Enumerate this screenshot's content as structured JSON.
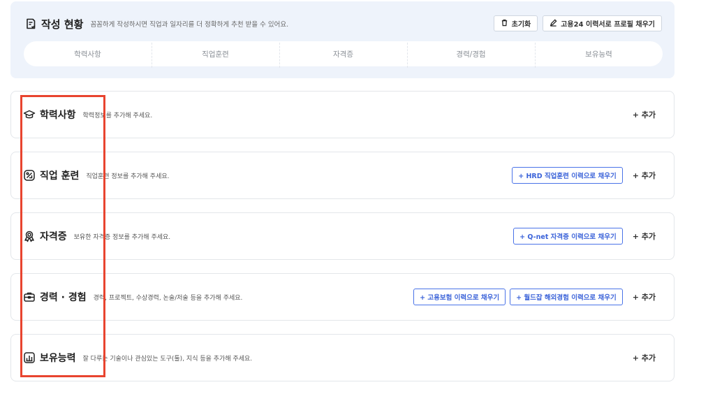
{
  "summary": {
    "title": "작성 현황",
    "description": "꼼꼼하게 작성하시면 직업과 일자리를 더 정확하게 추천 받을 수 있어요.",
    "reset_label": "초기화",
    "fill_profile_label": "고용24 이력서로 프로필 채우기",
    "tabs": [
      "학력사항",
      "직업훈련",
      "자격증",
      "경력/경험",
      "보유능력"
    ]
  },
  "sections": [
    {
      "title": "학력사항",
      "description": "학력정보를 추가해 주세요.",
      "icon": "graduation-cap-icon",
      "add_label": "+ 추가"
    },
    {
      "title": "직업 훈련",
      "description": "직업훈련 정보를 추가해 주세요.",
      "icon": "training-icon",
      "add_label": "+ 추가",
      "fill_buttons": [
        "+ HRD 직업훈련 이력으로 채우기"
      ]
    },
    {
      "title": "자격증",
      "description": "보유한 자격증 정보를 추가해 주세요.",
      "icon": "certificate-badge-icon",
      "add_label": "+ 추가",
      "fill_buttons": [
        "+ Q-net 자격증 이력으로 채우기"
      ]
    },
    {
      "title": "경력 · 경험",
      "description": "경력, 프로젝트, 수상경력, 논술/저술 등을 추가해 주세요.",
      "icon": "briefcase-icon",
      "add_label": "+ 추가",
      "fill_buttons": [
        "+ 고용보험 이력으로 채우기",
        "+ 월드잡 해외경험 이력으로 채우기"
      ]
    },
    {
      "title": "보유능력",
      "description": "잘 다루는 기술이나 관심있는 도구(툴), 지식 등을 추가해 주세요.",
      "icon": "skills-chart-icon",
      "add_label": "+ 추가"
    }
  ],
  "colors": {
    "accent_blue": "#3b63d9",
    "highlight_red": "#e8442f",
    "panel_bg": "#eef3fb"
  }
}
